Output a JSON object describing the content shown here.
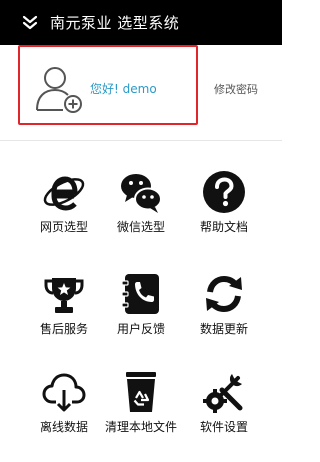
{
  "titlebar": {
    "collapse_icon": "double-chevron-down-icon",
    "title": "南元泵业 选型系统"
  },
  "user": {
    "avatar_icon": "user-add-icon",
    "greeting": "您好!  demo",
    "change_password": "修改密码"
  },
  "menu": [
    {
      "label": "网页选型",
      "icon": "ie-browser-icon"
    },
    {
      "label": "微信选型",
      "icon": "wechat-icon"
    },
    {
      "label": "帮助文档",
      "icon": "help-icon"
    },
    {
      "label": "售后服务",
      "icon": "trophy-icon"
    },
    {
      "label": "用户反馈",
      "icon": "phone-book-icon"
    },
    {
      "label": "数据更新",
      "icon": "refresh-icon"
    },
    {
      "label": "离线数据",
      "icon": "cloud-download-icon"
    },
    {
      "label": "清理本地文件",
      "icon": "recycle-bin-icon"
    },
    {
      "label": "软件设置",
      "icon": "settings-tools-icon"
    }
  ],
  "colors": {
    "titlebar_bg": "#000000",
    "highlight_border": "#e0262a",
    "greeting": "#2c9ac7",
    "icon": "#111111"
  }
}
